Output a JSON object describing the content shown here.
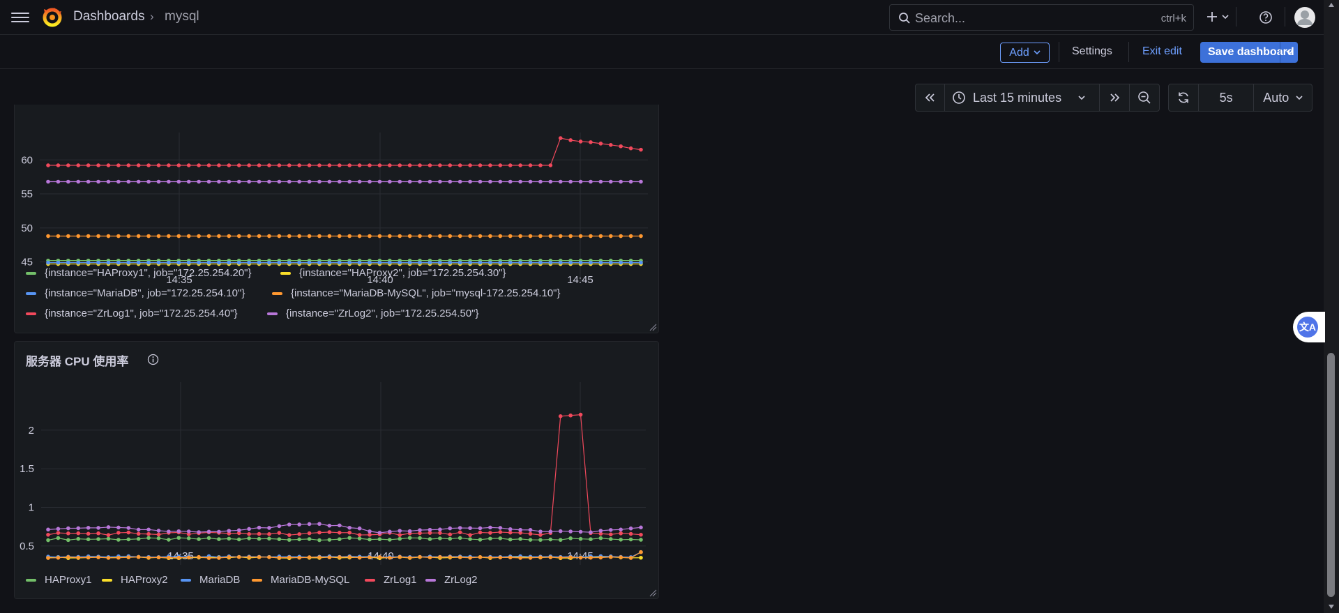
{
  "header": {
    "breadcrumb": [
      "Dashboards",
      "mysql"
    ],
    "breadcrumb_sep": "›",
    "search_placeholder": "Search...",
    "search_shortcut": "ctrl+k"
  },
  "toolbar": {
    "add_label": "Add",
    "settings_label": "Settings",
    "exit_edit_label": "Exit edit",
    "save_label": "Save dashboard"
  },
  "time_controls": {
    "range_label": "Last 15 minutes",
    "refresh_interval": "5s",
    "auto_label": "Auto"
  },
  "colors": {
    "HAProxy1": "#73bf69",
    "HAProxy2": "#fade2a",
    "MariaDB": "#5794f2",
    "MariaDB-MySQL": "#ff9830",
    "ZrLog1": "#f2495c",
    "ZrLog2": "#b877d9",
    "accent": "#3d71d9"
  },
  "panel1": {
    "legend": [
      "{instance=\"HAProxy1\", job=\"172.25.254.20\"}",
      "{instance=\"HAProxy2\", job=\"172.25.254.30\"}",
      "{instance=\"MariaDB\", job=\"172.25.254.10\"}",
      "{instance=\"MariaDB-MySQL\", job=\"mysql-172.25.254.10\"}",
      "{instance=\"ZrLog1\", job=\"172.25.254.40\"}",
      "{instance=\"ZrLog2\", job=\"172.25.254.50\"}"
    ]
  },
  "panel2": {
    "title": "服务器 CPU 使用率",
    "legend": [
      "HAProxy1",
      "HAProxy2",
      "MariaDB",
      "MariaDB-MySQL",
      "ZrLog1",
      "ZrLog2"
    ]
  },
  "chart_data": [
    {
      "type": "line",
      "title": "",
      "x_ticks": [
        "14:35",
        "14:40",
        "14:45"
      ],
      "y_ticks": [
        45,
        50,
        55,
        60
      ],
      "ylim": [
        42.5,
        63
      ],
      "points": 60,
      "series": [
        {
          "name": "{instance=\"HAProxy1\", job=\"172.25.254.20\"}",
          "key": "HAProxy1",
          "values": {
            "flat": 45.2
          }
        },
        {
          "name": "{instance=\"HAProxy2\", job=\"172.25.254.30\"}",
          "key": "HAProxy2",
          "values": {
            "flat": 44.7
          }
        },
        {
          "name": "{instance=\"MariaDB\", job=\"172.25.254.10\"}",
          "key": "MariaDB",
          "values": {
            "flat": 44.9
          }
        },
        {
          "name": "{instance=\"MariaDB-MySQL\", job=\"mysql-172.25.254.10\"}",
          "key": "MariaDB-MySQL",
          "values": {
            "flat": 48.8
          }
        },
        {
          "name": "{instance=\"ZrLog1\", job=\"172.25.254.40\"}",
          "key": "ZrLog1",
          "values": {
            "flat": 59.2,
            "tail": [
              63.2,
              62.9,
              62.7,
              62.6,
              62.4,
              62.2,
              62.0,
              61.7,
              61.5
            ]
          }
        },
        {
          "name": "{instance=\"ZrLog2\", job=\"172.25.254.50\"}",
          "key": "ZrLog2",
          "values": {
            "flat": 56.8
          }
        }
      ]
    },
    {
      "type": "line",
      "title": "服务器 CPU 使用率",
      "x_ticks": [
        "14:35",
        "14:40",
        "14:45"
      ],
      "y_ticks": [
        0.5,
        1,
        1.5,
        2
      ],
      "ylim": [
        0.3,
        2.35
      ],
      "points": 60,
      "series": [
        {
          "name": "HAProxy1",
          "key": "HAProxy1",
          "base": 0.59
        },
        {
          "name": "HAProxy2",
          "key": "HAProxy2",
          "base": 0.35
        },
        {
          "name": "MariaDB",
          "key": "MariaDB",
          "base": 0.36
        },
        {
          "name": "MariaDB-MySQL",
          "key": "MariaDB-MySQL",
          "base": 0.35
        },
        {
          "name": "ZrLog1",
          "key": "ZrLog1",
          "base": 0.66,
          "spike": [
            2.18,
            2.19,
            2.2
          ]
        },
        {
          "name": "ZrLog2",
          "key": "ZrLog2",
          "base": 0.7
        }
      ]
    }
  ]
}
